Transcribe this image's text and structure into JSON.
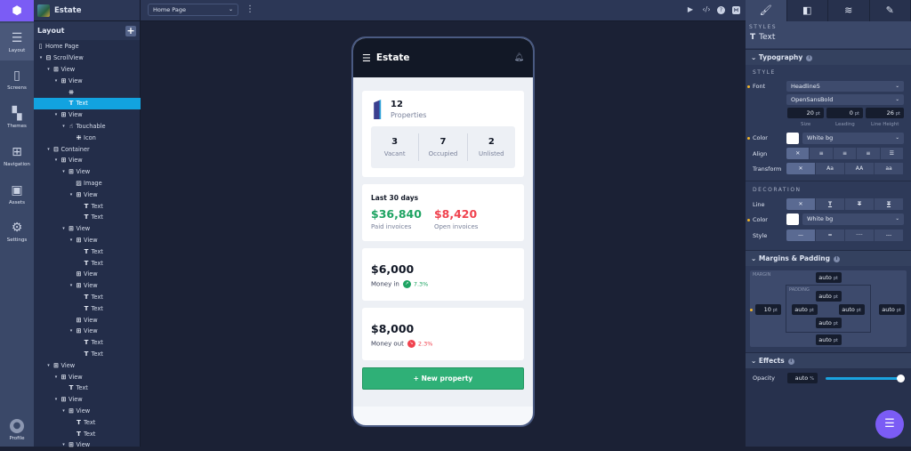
{
  "app": {
    "project_name": "Estate"
  },
  "rail": {
    "items": [
      {
        "label": "Layout",
        "icon": "layout-icon"
      },
      {
        "label": "Screens",
        "icon": "screens-icon"
      },
      {
        "label": "Themes",
        "icon": "themes-icon"
      },
      {
        "label": "Navigation",
        "icon": "navigation-icon"
      },
      {
        "label": "Assets",
        "icon": "assets-icon"
      },
      {
        "label": "Settings",
        "icon": "settings-icon"
      }
    ],
    "profile": "Profile"
  },
  "tree": {
    "title": "Layout",
    "add": "+",
    "items": [
      {
        "label": "Home Page",
        "icon": "page",
        "level": -1,
        "caret": false
      },
      {
        "label": "ScrollView",
        "icon": "scroll",
        "level": 0,
        "caret": true
      },
      {
        "label": "View",
        "icon": "view",
        "level": 1,
        "caret": true
      },
      {
        "label": "View",
        "icon": "view",
        "level": 2,
        "caret": true
      },
      {
        "label": "",
        "icon": "grid",
        "level": 3,
        "caret": false
      },
      {
        "label": "Text",
        "icon": "text",
        "level": 3,
        "caret": false,
        "selected": true
      },
      {
        "label": "View",
        "icon": "view",
        "level": 2,
        "caret": true
      },
      {
        "label": "Touchable",
        "icon": "touch",
        "level": 3,
        "caret": true
      },
      {
        "label": "Icon",
        "icon": "grid",
        "level": 4,
        "caret": false
      },
      {
        "label": "Container",
        "icon": "scroll",
        "level": 1,
        "caret": true
      },
      {
        "label": "View",
        "icon": "view",
        "level": 2,
        "caret": true
      },
      {
        "label": "View",
        "icon": "view",
        "level": 3,
        "caret": true
      },
      {
        "label": "Image",
        "icon": "image",
        "level": 4,
        "caret": false
      },
      {
        "label": "View",
        "icon": "view",
        "level": 4,
        "caret": true
      },
      {
        "label": "Text",
        "icon": "text",
        "level": 5,
        "caret": false
      },
      {
        "label": "Text",
        "icon": "text",
        "level": 5,
        "caret": false
      },
      {
        "label": "View",
        "icon": "view",
        "level": 3,
        "caret": true
      },
      {
        "label": "View",
        "icon": "view",
        "level": 4,
        "caret": true
      },
      {
        "label": "Text",
        "icon": "text",
        "level": 5,
        "caret": false
      },
      {
        "label": "Text",
        "icon": "text",
        "level": 5,
        "caret": false
      },
      {
        "label": "View",
        "icon": "view",
        "level": 4,
        "caret": false
      },
      {
        "label": "View",
        "icon": "view",
        "level": 4,
        "caret": true
      },
      {
        "label": "Text",
        "icon": "text",
        "level": 5,
        "caret": false
      },
      {
        "label": "Text",
        "icon": "text",
        "level": 5,
        "caret": false
      },
      {
        "label": "View",
        "icon": "view",
        "level": 4,
        "caret": false
      },
      {
        "label": "View",
        "icon": "view",
        "level": 4,
        "caret": true
      },
      {
        "label": "Text",
        "icon": "text",
        "level": 5,
        "caret": false
      },
      {
        "label": "Text",
        "icon": "text",
        "level": 5,
        "caret": false
      },
      {
        "label": "View",
        "icon": "view",
        "level": 1,
        "caret": true
      },
      {
        "label": "View",
        "icon": "view",
        "level": 2,
        "caret": true
      },
      {
        "label": "Text",
        "icon": "text",
        "level": 3,
        "caret": false
      },
      {
        "label": "View",
        "icon": "view",
        "level": 2,
        "caret": true
      },
      {
        "label": "View",
        "icon": "view",
        "level": 3,
        "caret": true
      },
      {
        "label": "Text",
        "icon": "text",
        "level": 4,
        "caret": false
      },
      {
        "label": "Text",
        "icon": "text",
        "level": 4,
        "caret": false
      },
      {
        "label": "View",
        "icon": "view",
        "level": 3,
        "caret": true
      }
    ]
  },
  "toolbar": {
    "page": "Home Page",
    "icons": [
      "play-icon",
      "code-icon",
      "help-icon",
      "share-icon"
    ]
  },
  "phone": {
    "title": "Estate",
    "properties": {
      "count": "12",
      "label": "Properties"
    },
    "stats": [
      {
        "value": "3",
        "label": "Vacant"
      },
      {
        "value": "7",
        "label": "Occupied"
      },
      {
        "value": "2",
        "label": "Unlisted"
      }
    ],
    "invoices": {
      "title": "Last 30 days",
      "paid": "$36,840",
      "paid_label": "Paid invoices",
      "open": "$8,420",
      "open_label": "Open invoices"
    },
    "money_in": {
      "amount": "$6,000",
      "label": "Money in",
      "change": "7.3%"
    },
    "money_out": {
      "amount": "$8,000",
      "label": "Money out",
      "change": "2.3%"
    },
    "button": "+ New property",
    "colors": {
      "green": "#1fa463",
      "red": "#f0424e",
      "button": "#2fb077"
    }
  },
  "panel": {
    "styles_label": "STYLES",
    "element": "Text",
    "typography": "Typography",
    "style_cap": "STYLE",
    "font_label": "Font",
    "font": "Headline5",
    "font_family": "OpenSansBold",
    "size": "20",
    "leading": "0",
    "line_height": "26",
    "unit": "pt",
    "size_label": "Size",
    "leading_label": "Leading",
    "line_height_label": "Line Height",
    "color_label": "Color",
    "color": "White bg",
    "align_label": "Align",
    "transform_label": "Transform",
    "transform_options": [
      "✕",
      "Aa",
      "AA",
      "aa"
    ],
    "decoration_cap": "DECORATION",
    "line_label": "Line",
    "deco_color_label": "Color",
    "deco_color": "White bg",
    "style_label": "Style",
    "margins": "Margins & Padding",
    "margin_cap": "MARGIN",
    "padding_cap": "PADDING",
    "margin_left": "10",
    "auto": "auto",
    "effects": "Effects",
    "opacity_label": "Opacity",
    "opacity": "auto",
    "opacity_unit": "%",
    "opacity_level": 1.0
  }
}
